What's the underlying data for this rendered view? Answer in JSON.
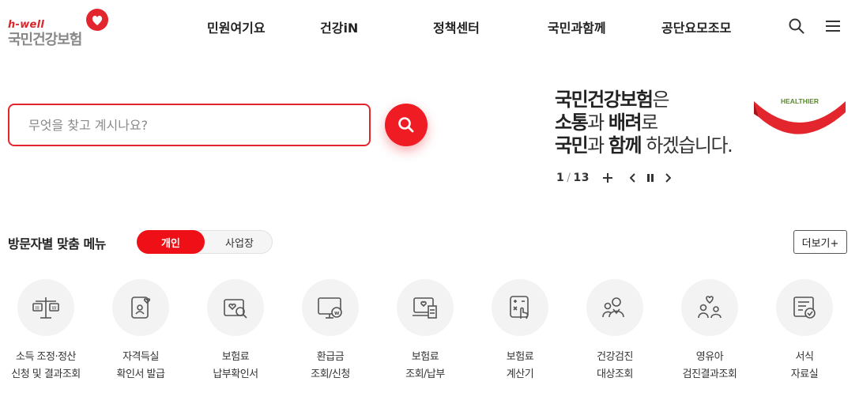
{
  "logo": {
    "tagline": "h-well",
    "name": "국민건강보험"
  },
  "gnb": [
    "민원여기요",
    "건강iN",
    "정책센터",
    "국민과함께",
    "공단요모조모"
  ],
  "header_icons": {
    "search": "search-icon",
    "menu": "hamburger-menu-icon"
  },
  "search": {
    "placeholder": "무엇을 찾고 계시나요?",
    "value": ""
  },
  "banner": {
    "line1_bold": "국민건강보험",
    "line1_rest": "은",
    "line2_bold1": "소통",
    "line2_mid": "과 ",
    "line2_bold2": "배려",
    "line2_rest": "로",
    "line3_bold1": "국민",
    "line3_mid": "과 ",
    "line3_bold2": "함께",
    "line3_rest": " 하겠습니다.",
    "logo_text": "HEALTHIER",
    "current": "1",
    "total": "13"
  },
  "section": {
    "title": "방문자별 맞춤 메뉴",
    "tab_active": "개인",
    "tab_inactive": "사업장",
    "more": "더보기+"
  },
  "quick_menu": [
    {
      "icon": "scale-icon",
      "line1": "소득 조정·정산",
      "line2": "신청 및 결과조회"
    },
    {
      "icon": "id-card-heart-icon",
      "line1": "자격득실",
      "line2": "확인서 발급"
    },
    {
      "icon": "search-document-icon",
      "line1": "보험료",
      "line2": "납부확인서"
    },
    {
      "icon": "monitor-coin-icon",
      "line1": "환급금",
      "line2": "조회/신청"
    },
    {
      "icon": "laptop-bill-icon",
      "line1": "보험료",
      "line2": "조회/납부"
    },
    {
      "icon": "calculator-hand-icon",
      "line1": "보험료",
      "line2": "계산기"
    },
    {
      "icon": "people-checkup-icon",
      "line1": "건강검진",
      "line2": "대상조회"
    },
    {
      "icon": "family-heart-icon",
      "line1": "영유아",
      "line2": "검진결과조회"
    },
    {
      "icon": "document-check-icon",
      "line1": "서식",
      "line2": "자료실"
    }
  ],
  "colors": {
    "brand_red": "#ef0f17",
    "icon_gray": "#555555",
    "circle_bg": "#f3f3f3"
  }
}
